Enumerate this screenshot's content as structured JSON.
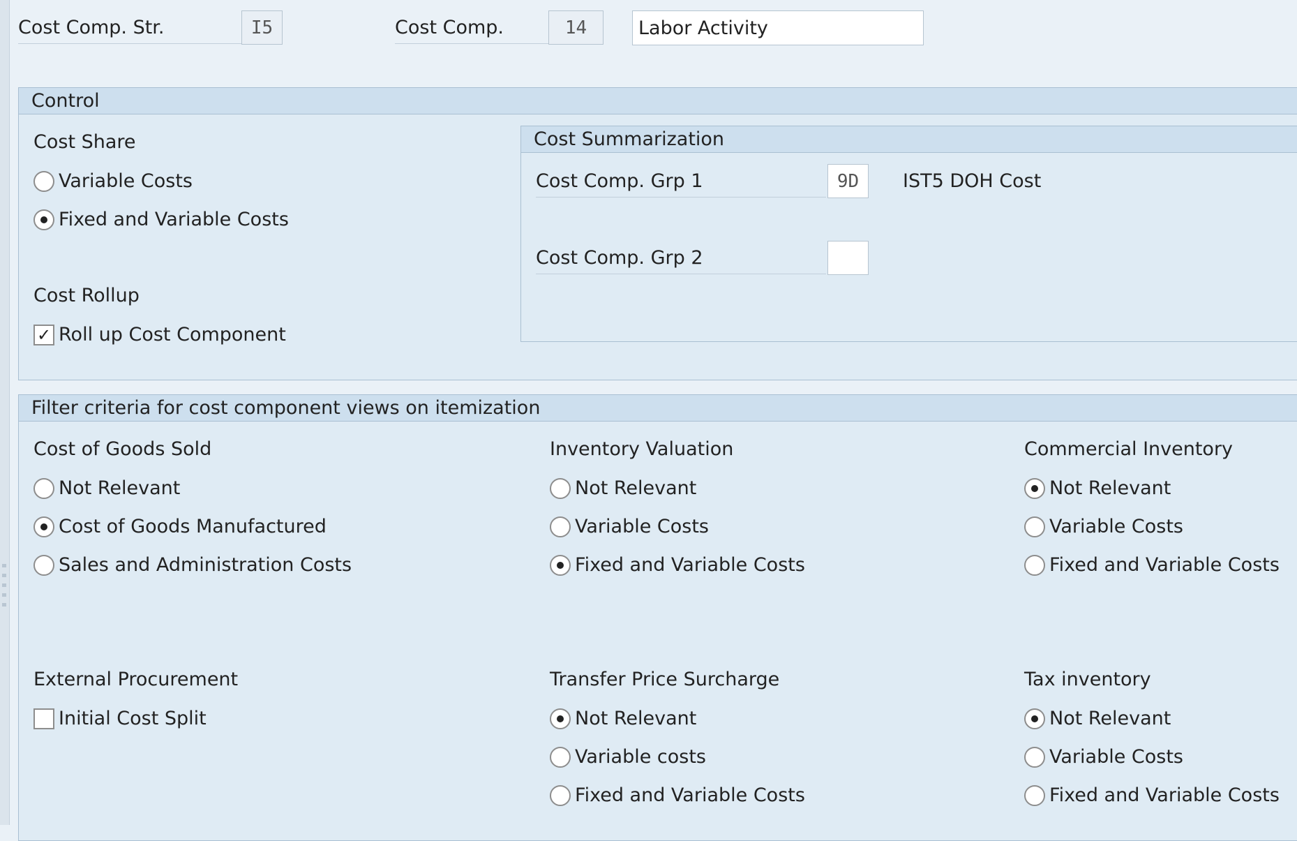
{
  "header": {
    "cost_comp_str_label": "Cost Comp. Str.",
    "cost_comp_str_value": "I5",
    "cost_comp_label": "Cost Comp.",
    "cost_comp_value": "14",
    "cost_comp_desc": "Labor Activity"
  },
  "control": {
    "title": "Control",
    "cost_share": {
      "label": "Cost Share",
      "options": [
        {
          "label": "Variable Costs",
          "selected": false
        },
        {
          "label": "Fixed and Variable Costs",
          "selected": true
        }
      ]
    },
    "cost_rollup": {
      "label": "Cost Rollup",
      "checkbox_label": "Roll up Cost Component",
      "checked": true
    },
    "summarization": {
      "title": "Cost Summarization",
      "grp1_label": "Cost Comp. Grp 1",
      "grp1_value": "9D",
      "grp1_desc": "IST5 DOH Cost",
      "grp2_label": "Cost Comp. Grp 2",
      "grp2_value": ""
    }
  },
  "filter": {
    "title": "Filter criteria for cost component views on itemization",
    "cogs": {
      "label": "Cost of Goods Sold",
      "options": [
        {
          "label": "Not Relevant",
          "selected": false
        },
        {
          "label": "Cost of Goods Manufactured",
          "selected": true
        },
        {
          "label": "Sales and Administration Costs",
          "selected": false
        }
      ]
    },
    "inventory_valuation": {
      "label": "Inventory Valuation",
      "options": [
        {
          "label": "Not Relevant",
          "selected": false
        },
        {
          "label": "Variable Costs",
          "selected": false
        },
        {
          "label": "Fixed and Variable Costs",
          "selected": true
        }
      ]
    },
    "commercial_inventory": {
      "label": "Commercial Inventory",
      "options": [
        {
          "label": "Not Relevant",
          "selected": true
        },
        {
          "label": "Variable Costs",
          "selected": false
        },
        {
          "label": "Fixed and Variable Costs",
          "selected": false
        }
      ]
    },
    "external_procurement": {
      "label": "External Procurement",
      "checkbox_label": "Initial Cost Split",
      "checked": false
    },
    "transfer_price": {
      "label": "Transfer Price Surcharge",
      "options": [
        {
          "label": "Not Relevant",
          "selected": true
        },
        {
          "label": "Variable costs",
          "selected": false
        },
        {
          "label": "Fixed and Variable Costs",
          "selected": false
        }
      ]
    },
    "tax_inventory": {
      "label": "Tax inventory",
      "options": [
        {
          "label": "Not Relevant",
          "selected": true
        },
        {
          "label": "Variable Costs",
          "selected": false
        },
        {
          "label": "Fixed and Variable Costs",
          "selected": false
        }
      ]
    }
  }
}
